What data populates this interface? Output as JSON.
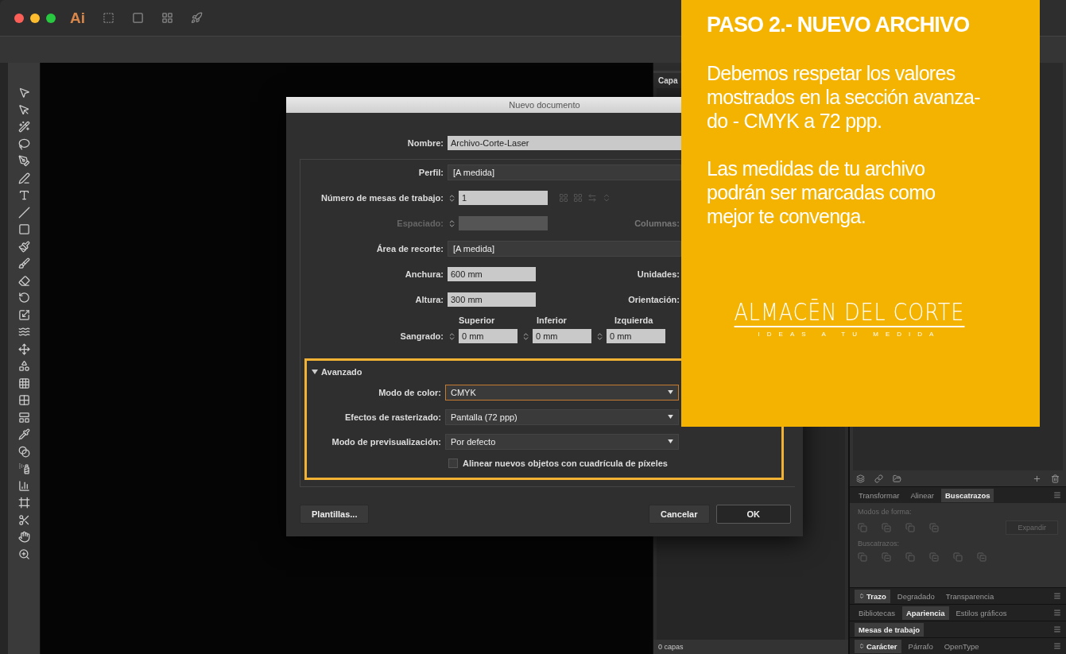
{
  "app": {
    "logo": "Ai"
  },
  "layers_panel": {
    "tab": "Capa",
    "footer": "0 capas"
  },
  "pathfinder_panel": {
    "tabs": [
      {
        "label": "Transformar",
        "selected": false
      },
      {
        "label": "Alinear",
        "selected": false
      },
      {
        "label": "Buscatrazos",
        "selected": true
      }
    ],
    "disabled": true,
    "shape_modes_label": "Modos de forma:",
    "expand_button": "Expandir",
    "pathfinders_label": "Buscatrazos:"
  },
  "panel_groups": [
    {
      "kind": "collapsible",
      "tabs": [
        {
          "label": "Trazo",
          "selected": true
        },
        {
          "label": "Degradado",
          "selected": false
        },
        {
          "label": "Transparencia",
          "selected": false
        }
      ]
    },
    {
      "kind": "plain",
      "tabs": [
        {
          "label": "Bibliotecas",
          "selected": false
        },
        {
          "label": "Apariencia",
          "selected": true
        },
        {
          "label": "Estilos gráficos",
          "selected": false
        }
      ]
    },
    {
      "kind": "plain",
      "tabs": [
        {
          "label": "Mesas de trabajo",
          "selected": true
        }
      ]
    },
    {
      "kind": "collapsible",
      "tabs": [
        {
          "label": "Carácter",
          "selected": true
        },
        {
          "label": "Párrafo",
          "selected": false
        },
        {
          "label": "OpenType",
          "selected": false
        }
      ]
    }
  ],
  "dialog": {
    "title": "Nuevo documento",
    "name": {
      "label": "Nombre:",
      "value": "Archivo-Corte-Laser"
    },
    "profile": {
      "label": "Perfil:",
      "value": "[A medida]"
    },
    "artboards": {
      "label": "Número de mesas de trabajo:",
      "value": "1"
    },
    "spacing": {
      "label": "Espaciado:",
      "disabled": true
    },
    "columns_label": "Columnas:",
    "crop_area": {
      "label": "Área de recorte:",
      "value": "[A medida]"
    },
    "width": {
      "label": "Anchura:",
      "value": "600 mm"
    },
    "units_label": "Unidades:",
    "height": {
      "label": "Altura:",
      "value": "300 mm"
    },
    "orientation_label": "Orientación:",
    "bleed": {
      "label": "Sangrado:",
      "sides": [
        {
          "label": "Superior",
          "value": "0 mm"
        },
        {
          "label": "Inferior",
          "value": "0 mm"
        },
        {
          "label": "Izquierda",
          "value": "0 mm"
        }
      ]
    },
    "advanced": {
      "label": "Avanzado",
      "expanded": true,
      "highlighted": true,
      "fields": [
        {
          "label": "Modo de color:",
          "value": "CMYK",
          "focused": true
        },
        {
          "label": "Efectos de rasterizado:",
          "value": "Pantalla (72 ppp)",
          "focused": false
        },
        {
          "label": "Modo de previsualización:",
          "value": "Por defecto",
          "focused": false
        }
      ],
      "pixel_align": {
        "label": "Alinear nuevos objetos con cuadrícula de píxeles",
        "checked": false
      }
    },
    "buttons": [
      {
        "label": "Plantillas...",
        "kind": "left",
        "default": false
      },
      {
        "label": "Cancelar",
        "kind": "right",
        "default": false
      },
      {
        "label": "OK",
        "kind": "right",
        "default": true
      }
    ]
  },
  "overlay": {
    "title": "PASO 2.- NUEVO ARCHIVO",
    "paragraphs": [
      "Debemos respetar los valores\nmostrados en la sección avanza-\ndo - CMYK a 72 ppp.",
      "Las medidas de tu archivo\npodrán ser marcadas como\nmejor te convenga."
    ],
    "logo": "ALMACĒN DEL CORTE",
    "tagline": "IDEAS A TU MEDIDA"
  }
}
